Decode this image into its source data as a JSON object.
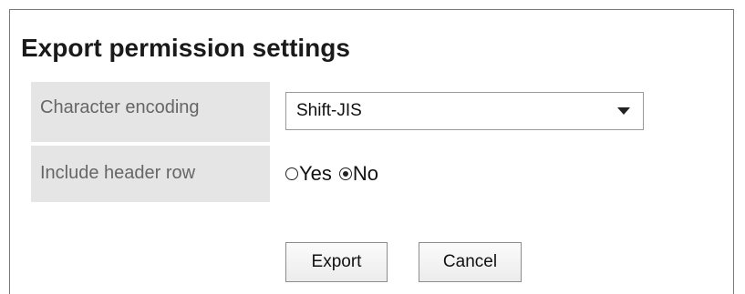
{
  "page": {
    "title": "Export permission settings"
  },
  "form": {
    "encoding": {
      "label": "Character encoding",
      "selected": "Shift-JIS"
    },
    "header_row": {
      "label": "Include header row",
      "options": [
        {
          "label": "Yes",
          "checked": false
        },
        {
          "label": "No",
          "checked": true
        }
      ]
    }
  },
  "actions": {
    "export_label": "Export",
    "cancel_label": "Cancel"
  },
  "icons": {
    "select_arrow": "chevron-down-icon",
    "radio_unchecked": "radio-unchecked-icon",
    "radio_checked": "radio-checked-icon"
  }
}
